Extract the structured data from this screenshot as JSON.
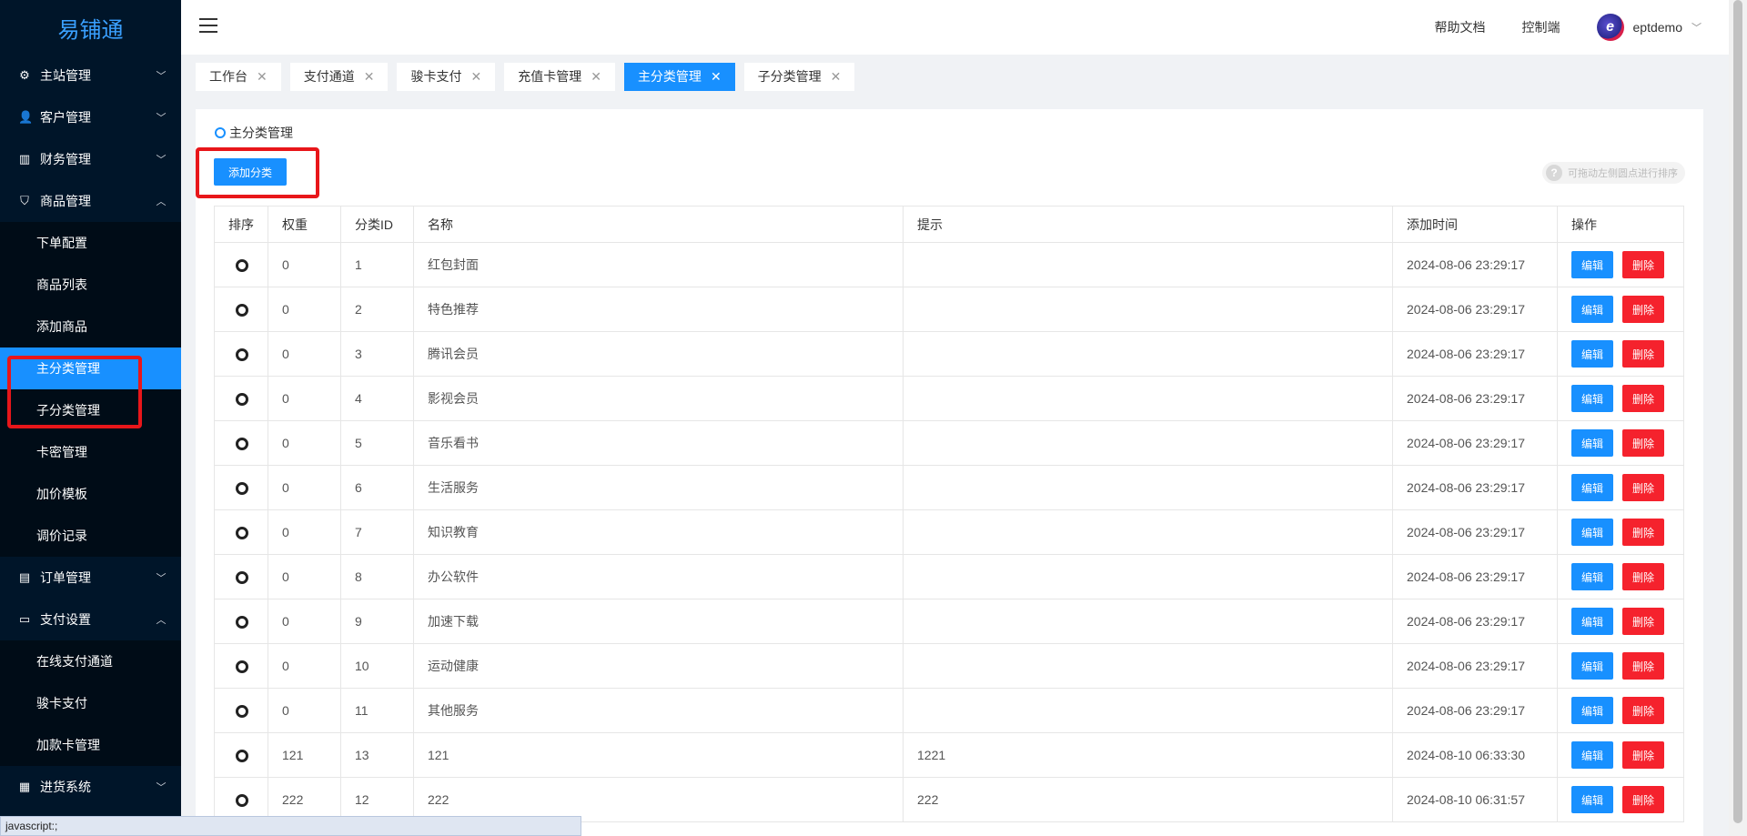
{
  "app": {
    "logo": "易铺通"
  },
  "sidebar": {
    "groups": [
      {
        "label": "主站管理",
        "icon": "gear-icon",
        "glyph": "⚙",
        "chevron": "﹀"
      },
      {
        "label": "客户管理",
        "icon": "user-icon",
        "glyph": "👤",
        "chevron": "﹀"
      },
      {
        "label": "财务管理",
        "icon": "bar-chart-icon",
        "glyph": "▥",
        "chevron": "﹀"
      },
      {
        "label": "商品管理",
        "icon": "bag-icon",
        "glyph": "⛉",
        "chevron": "︿"
      },
      {
        "label": "订单管理",
        "icon": "clipboard-icon",
        "glyph": "▤",
        "chevron": "﹀"
      },
      {
        "label": "支付设置",
        "icon": "wallet-icon",
        "glyph": "▭",
        "chevron": "︿"
      },
      {
        "label": "进货系统",
        "icon": "calendar-icon",
        "glyph": "▦",
        "chevron": "﹀"
      }
    ],
    "goods_sub": [
      "下单配置",
      "商品列表",
      "添加商品",
      "主分类管理",
      "子分类管理",
      "卡密管理",
      "加价模板",
      "调价记录"
    ],
    "pay_sub": [
      "在线支付通道",
      "骏卡支付",
      "加款卡管理"
    ]
  },
  "header": {
    "help": "帮助文档",
    "console": "控制端",
    "username": "eptdemo",
    "user_chevron": "﹀",
    "avatar_letter": "e"
  },
  "tabs": [
    {
      "label": "工作台",
      "close": "✕"
    },
    {
      "label": "支付通道",
      "close": "✕"
    },
    {
      "label": "骏卡支付",
      "close": "✕"
    },
    {
      "label": "充值卡管理",
      "close": "✕"
    },
    {
      "label": "主分类管理",
      "close": "✕",
      "active": true
    },
    {
      "label": "子分类管理",
      "close": "✕"
    }
  ],
  "main": {
    "title": "主分类管理",
    "add_button": "添加分类",
    "tip": "可拖动左侧圆点进行排序",
    "tip_icon": "?",
    "columns": [
      "排序",
      "权重",
      "分类ID",
      "名称",
      "提示",
      "添加时间",
      "操作"
    ],
    "edit_label": "编辑",
    "delete_label": "删除",
    "rows": [
      {
        "weight": "0",
        "id": "1",
        "name": "红包封面",
        "hint": "",
        "time": "2024-08-06 23:29:17"
      },
      {
        "weight": "0",
        "id": "2",
        "name": "特色推荐",
        "hint": "",
        "time": "2024-08-06 23:29:17"
      },
      {
        "weight": "0",
        "id": "3",
        "name": "腾讯会员",
        "hint": "",
        "time": "2024-08-06 23:29:17"
      },
      {
        "weight": "0",
        "id": "4",
        "name": "影视会员",
        "hint": "",
        "time": "2024-08-06 23:29:17"
      },
      {
        "weight": "0",
        "id": "5",
        "name": "音乐看书",
        "hint": "",
        "time": "2024-08-06 23:29:17"
      },
      {
        "weight": "0",
        "id": "6",
        "name": "生活服务",
        "hint": "",
        "time": "2024-08-06 23:29:17"
      },
      {
        "weight": "0",
        "id": "7",
        "name": "知识教育",
        "hint": "",
        "time": "2024-08-06 23:29:17"
      },
      {
        "weight": "0",
        "id": "8",
        "name": "办公软件",
        "hint": "",
        "time": "2024-08-06 23:29:17"
      },
      {
        "weight": "0",
        "id": "9",
        "name": "加速下载",
        "hint": "",
        "time": "2024-08-06 23:29:17"
      },
      {
        "weight": "0",
        "id": "10",
        "name": "运动健康",
        "hint": "",
        "time": "2024-08-06 23:29:17"
      },
      {
        "weight": "0",
        "id": "11",
        "name": "其他服务",
        "hint": "",
        "time": "2024-08-06 23:29:17"
      },
      {
        "weight": "121",
        "id": "13",
        "name": "121",
        "hint": "1221",
        "time": "2024-08-10 06:33:30"
      },
      {
        "weight": "222",
        "id": "12",
        "name": "222",
        "hint": "222",
        "time": "2024-08-10 06:31:57"
      }
    ]
  },
  "status": {
    "text": "javascript:;"
  },
  "colors": {
    "sidebar_bg": "#001529",
    "submenu_bg": "#000c17",
    "accent": "#1890ff",
    "danger": "#f5222d",
    "highlight": "#e8161a"
  }
}
